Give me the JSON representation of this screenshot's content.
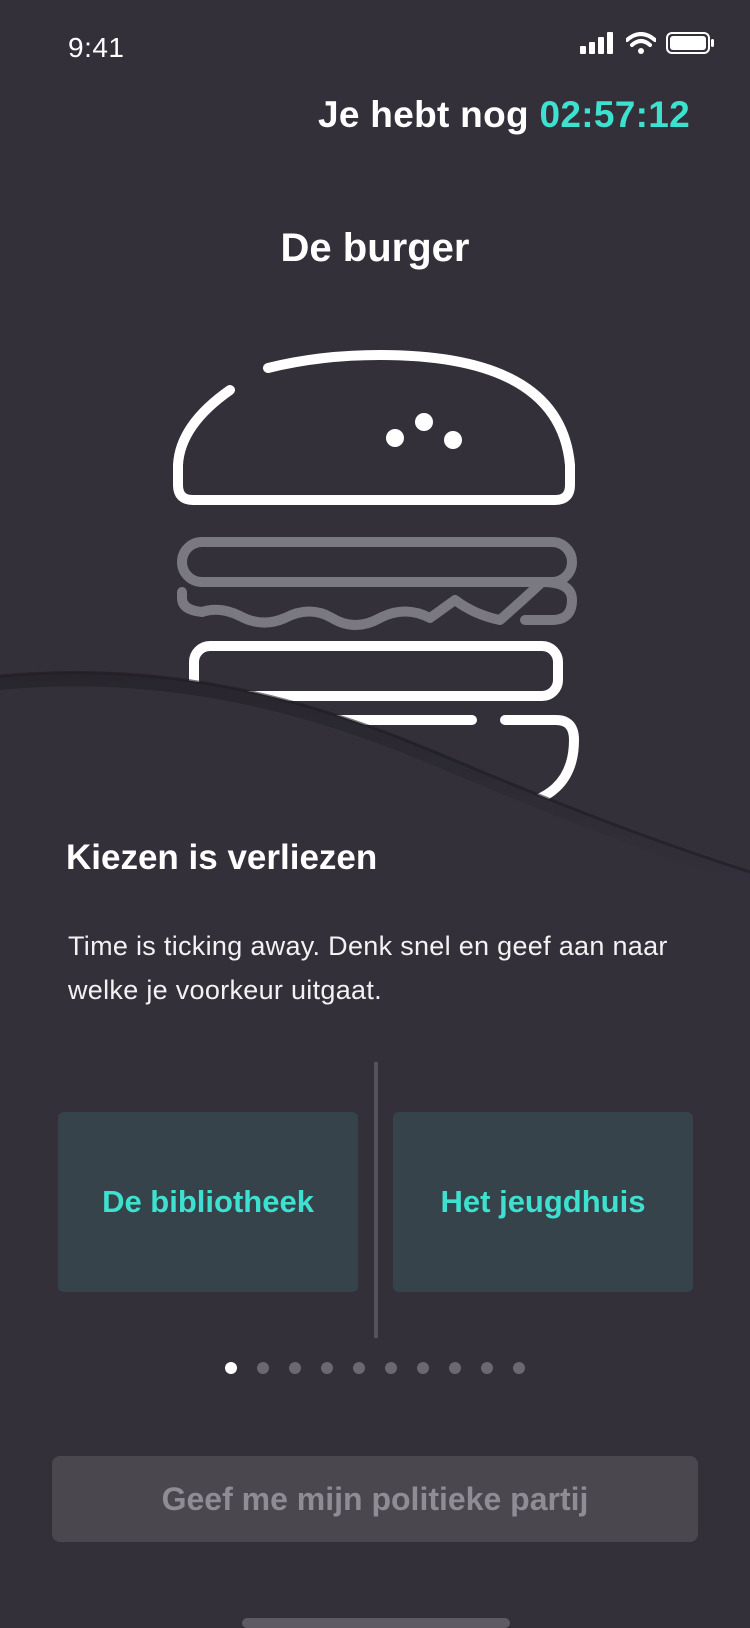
{
  "status_bar": {
    "time": "9:41",
    "icons": [
      "signal-icon",
      "wifi-icon",
      "battery-icon"
    ]
  },
  "timer": {
    "prefix": "Je hebt nog",
    "value": "02:57:12"
  },
  "question": {
    "title": "De burger",
    "illustration": "burger-icon"
  },
  "section": {
    "title": "Kiezen is verliezen",
    "text": "Time is ticking away. Denk snel en geef aan naar welke je voorkeur uitgaat."
  },
  "options": {
    "left": "De bibliotheek",
    "right": "Het jeugdhuis"
  },
  "pagination": {
    "total": 10,
    "current": 1
  },
  "cta": {
    "label": "Geef me mijn politieke partij"
  },
  "colors": {
    "background": "#33303a",
    "accent": "#3ee0cf",
    "option_background": "#36434a",
    "cta_background": "#4a474f",
    "cta_text": "#8f8c95"
  }
}
